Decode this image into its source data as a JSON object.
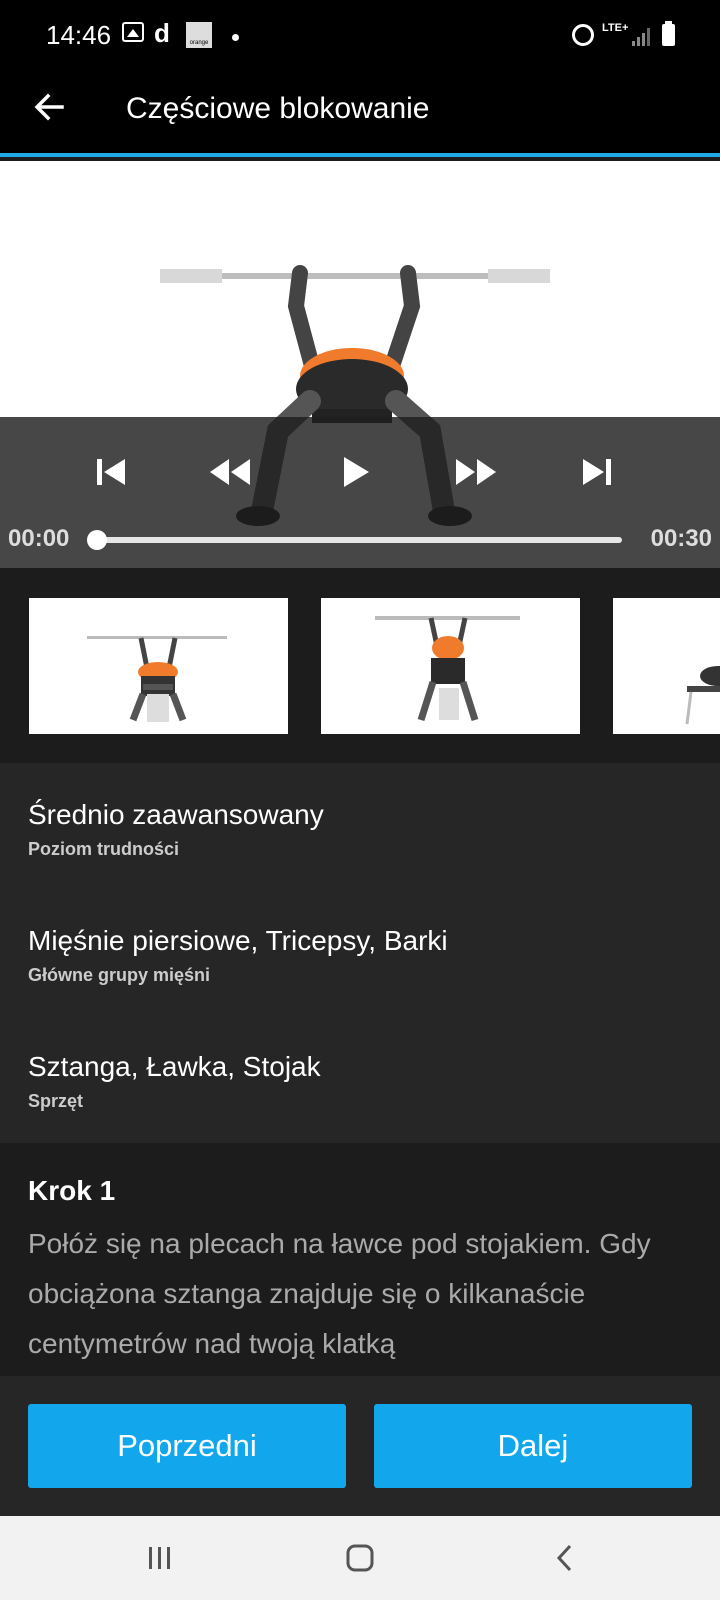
{
  "status_bar": {
    "time": "14:46",
    "carrier_label": "orange",
    "network_label": "LTE+",
    "icons": [
      "gallery-icon",
      "d-icon",
      "orange-icon",
      "dot-icon",
      "alarm-icon",
      "signal-icon",
      "battery-icon"
    ]
  },
  "app_bar": {
    "title": "Częściowe blokowanie",
    "back_icon": "arrow-left-icon"
  },
  "video": {
    "current_time": "00:00",
    "duration": "00:30",
    "progress": 0,
    "controls": [
      "skip-previous-icon",
      "rewind-icon",
      "play-icon",
      "fast-forward-icon",
      "skip-next-icon"
    ]
  },
  "thumbnails": {
    "count_visible": 3
  },
  "info": {
    "items": [
      {
        "value": "Średnio zaawansowany",
        "label": "Poziom trudności"
      },
      {
        "value": "Mięśnie piersiowe, Tricepsy, Barki",
        "label": "Główne grupy mięśni"
      },
      {
        "value": "Sztanga, Ławka, Stojak",
        "label": "Sprzęt"
      }
    ]
  },
  "step": {
    "title": "Krok 1",
    "text": "Połóż się na plecach na ławce pod stojakiem. Gdy obciążona sztanga znajduje się o kilkanaście centymetrów nad twoją klatką"
  },
  "buttons": {
    "previous_label": "Poprzedni",
    "next_label": "Dalej"
  },
  "system_nav": {
    "icons": [
      "recents-icon",
      "home-icon",
      "back-icon"
    ]
  },
  "colors": {
    "accent": "#12a7ec",
    "header_line": "#1fa9e8",
    "background": "#1c1c1c",
    "panel": "#262626"
  }
}
